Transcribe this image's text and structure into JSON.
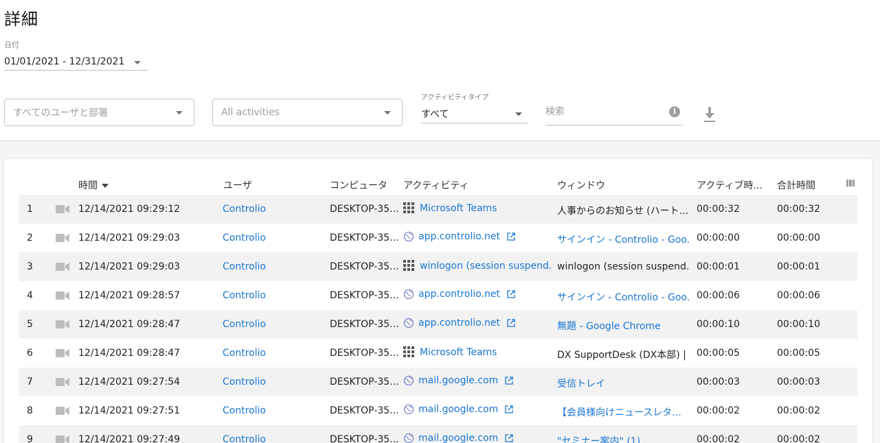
{
  "page": {
    "title": "詳細"
  },
  "filters": {
    "date_label": "日付",
    "date_value": "01/01/2021 - 12/31/2021",
    "users_placeholder": "すべてのユーザと部署",
    "activities_placeholder": "All activities",
    "activity_type_label": "アクティビティタイプ",
    "activity_type_value": "すべて",
    "search_placeholder": "検索",
    "info_icon": "info-icon",
    "download_icon": "download-icon"
  },
  "table": {
    "headers": {
      "time": "時間",
      "user": "ユーザ",
      "computer": "コンピュータ",
      "activity": "アクティビティ",
      "window": "ウィンドウ",
      "active_time": "アクティブ時...",
      "total_time": "合計時間"
    },
    "rows": [
      {
        "num": "1",
        "time": "12/14/2021 09:29:12",
        "user": "Controlio",
        "computer": "DESKTOP-35...",
        "activity": "Microsoft Teams",
        "activity_icon": "grid-icon",
        "external": false,
        "window": "人事からのお知らせ (ハート...",
        "window_link": false,
        "active": "00:00:32",
        "total": "00:00:32"
      },
      {
        "num": "2",
        "time": "12/14/2021 09:29:03",
        "user": "Controlio",
        "computer": "DESKTOP-35...",
        "activity": "app.controlio.net",
        "activity_icon": "globe-icon",
        "external": true,
        "window": "サインイン - Controlio - Goo...",
        "window_link": true,
        "active": "00:00:00",
        "total": "00:00:00"
      },
      {
        "num": "3",
        "time": "12/14/2021 09:29:03",
        "user": "Controlio",
        "computer": "DESKTOP-35...",
        "activity": "winlogon (session suspend...",
        "activity_icon": "grid-icon",
        "external": false,
        "window": "winlogon (session suspend...",
        "window_link": false,
        "active": "00:00:01",
        "total": "00:00:01"
      },
      {
        "num": "4",
        "time": "12/14/2021 09:28:57",
        "user": "Controlio",
        "computer": "DESKTOP-35...",
        "activity": "app.controlio.net",
        "activity_icon": "globe-icon",
        "external": true,
        "window": "サインイン - Controlio - Goo...",
        "window_link": true,
        "active": "00:00:06",
        "total": "00:00:06"
      },
      {
        "num": "5",
        "time": "12/14/2021 09:28:47",
        "user": "Controlio",
        "computer": "DESKTOP-35...",
        "activity": "app.controlio.net",
        "activity_icon": "globe-icon",
        "external": true,
        "window": "無題 - Google Chrome",
        "window_link": true,
        "active": "00:00:10",
        "total": "00:00:10"
      },
      {
        "num": "6",
        "time": "12/14/2021 09:28:47",
        "user": "Controlio",
        "computer": "DESKTOP-35...",
        "activity": "Microsoft Teams",
        "activity_icon": "grid-icon",
        "external": false,
        "window": "DX SupportDesk (DX本部) | ...",
        "window_link": false,
        "active": "00:00:05",
        "total": "00:00:05"
      },
      {
        "num": "7",
        "time": "12/14/2021 09:27:54",
        "user": "Controlio",
        "computer": "DESKTOP-35...",
        "activity": "mail.google.com",
        "activity_icon": "globe-icon",
        "external": true,
        "window": "受信トレイ",
        "window_link": true,
        "active": "00:00:03",
        "total": "00:00:03"
      },
      {
        "num": "8",
        "time": "12/14/2021 09:27:51",
        "user": "Controlio",
        "computer": "DESKTOP-35...",
        "activity": "mail.google.com",
        "activity_icon": "globe-icon",
        "external": true,
        "window": "【会員様向けニュースレタ...",
        "window_link": true,
        "active": "00:00:02",
        "total": "00:00:02"
      },
      {
        "num": "9",
        "time": "12/14/2021 09:27:49",
        "user": "Controlio",
        "computer": "DESKTOP-35...",
        "activity": "mail.google.com",
        "activity_icon": "globe-icon",
        "external": true,
        "window": "\"セミナー案内\" (1)",
        "window_link": true,
        "active": "00:00:02",
        "total": "00:00:02"
      }
    ]
  },
  "colors": {
    "link": "#1976d2",
    "row_alt": "#f2f2f2",
    "icon_gray": "#9e9e9e"
  }
}
